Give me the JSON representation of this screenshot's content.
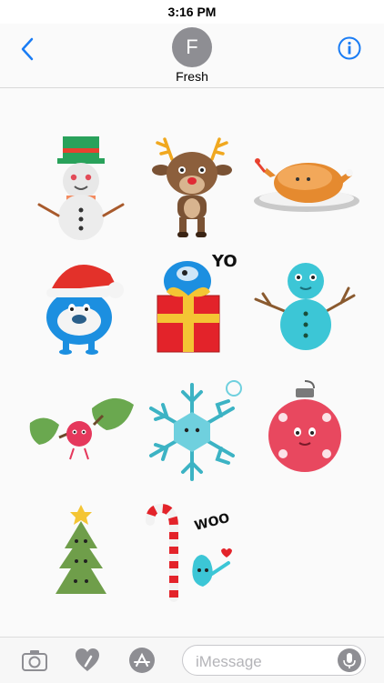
{
  "status": {
    "time": "3:16 PM"
  },
  "header": {
    "avatar_initial": "F",
    "contact_name": "Fresh"
  },
  "stickers": [
    {
      "name": "snowman-top-hat",
      "text": ""
    },
    {
      "name": "reindeer",
      "text": ""
    },
    {
      "name": "roast-turkey",
      "text": ""
    },
    {
      "name": "santa-hat-monster",
      "text": ""
    },
    {
      "name": "gift-box-monster",
      "text": "YO"
    },
    {
      "name": "blue-snowman",
      "text": ""
    },
    {
      "name": "holly-berry",
      "text": ""
    },
    {
      "name": "snowflake",
      "text": ""
    },
    {
      "name": "pink-ornament",
      "text": ""
    },
    {
      "name": "christmas-tree",
      "text": ""
    },
    {
      "name": "candy-cane-drop",
      "text": "WOO"
    }
  ],
  "toolbar": {
    "placeholder": "iMessage"
  },
  "colors": {
    "accent": "#1a7cf4",
    "avatar": "#8e8e93"
  }
}
